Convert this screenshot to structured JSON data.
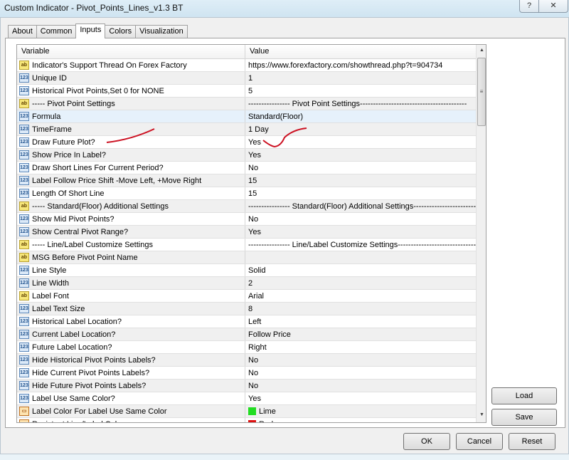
{
  "window": {
    "title": "Custom Indicator - Pivot_Points_Lines_v1.3 BT",
    "help": "?",
    "close": "✕"
  },
  "tabs": [
    {
      "label": "About"
    },
    {
      "label": "Common"
    },
    {
      "label": "Inputs",
      "active": true
    },
    {
      "label": "Colors"
    },
    {
      "label": "Visualization"
    }
  ],
  "grid": {
    "headers": {
      "variable": "Variable",
      "value": "Value"
    },
    "rows": [
      {
        "icon": "ab",
        "variable": "Indicator's Support Thread On Forex Factory",
        "value": "https://www.forexfactory.com/showthread.php?t=904734"
      },
      {
        "icon": "123",
        "variable": "Unique ID",
        "value": "1"
      },
      {
        "icon": "123",
        "variable": "Historical Pivot Points,Set 0 for NONE",
        "value": "5"
      },
      {
        "icon": "ab",
        "variable": "----- Pivot Point Settings",
        "value": "---------------- Pivot Point Settings-----------------------------------------"
      },
      {
        "icon": "123",
        "variable": "Formula",
        "value": "Standard(Floor)",
        "selected": true
      },
      {
        "icon": "123",
        "variable": "TimeFrame",
        "value": "1 Day"
      },
      {
        "icon": "123",
        "variable": "Draw Future Plot?",
        "value": "Yes"
      },
      {
        "icon": "123",
        "variable": "Show Price In Label?",
        "value": "Yes"
      },
      {
        "icon": "123",
        "variable": "Draw Short Lines For Current Period?",
        "value": "No"
      },
      {
        "icon": "123",
        "variable": "Label Follow Price Shift -Move Left, +Move Right",
        "value": "15"
      },
      {
        "icon": "123",
        "variable": "Length Of Short Line",
        "value": "15"
      },
      {
        "icon": "ab",
        "variable": "----- Standard(Floor) Additional Settings",
        "value": "---------------- Standard(Floor) Additional Settings-------------------------------"
      },
      {
        "icon": "123",
        "variable": "Show Mid Pivot Points?",
        "value": "No"
      },
      {
        "icon": "123",
        "variable": "Show Central Pivot Range?",
        "value": "Yes"
      },
      {
        "icon": "ab",
        "variable": "----- Line/Label Customize Settings",
        "value": "---------------- Line/Label Customize Settings---------------------------------"
      },
      {
        "icon": "ab",
        "variable": "MSG Before Pivot Point Name",
        "value": ""
      },
      {
        "icon": "123",
        "variable": "Line Style",
        "value": "Solid"
      },
      {
        "icon": "123",
        "variable": "Line Width",
        "value": "2"
      },
      {
        "icon": "ab",
        "variable": "Label Font",
        "value": "Arial"
      },
      {
        "icon": "123",
        "variable": "Label Text Size",
        "value": "8"
      },
      {
        "icon": "123",
        "variable": "Historical Label Location?",
        "value": "Left"
      },
      {
        "icon": "123",
        "variable": "Current Label Location?",
        "value": "Follow Price"
      },
      {
        "icon": "123",
        "variable": "Future Label Location?",
        "value": "Right"
      },
      {
        "icon": "123",
        "variable": "Hide Historical Pivot Points Labels?",
        "value": "No"
      },
      {
        "icon": "123",
        "variable": "Hide Current Pivot Points Labels?",
        "value": "No"
      },
      {
        "icon": "123",
        "variable": "Hide Future Pivot Points Labels?",
        "value": "No"
      },
      {
        "icon": "123",
        "variable": "Label Use Same Color?",
        "value": "Yes"
      },
      {
        "icon": "color",
        "variable": "Label Color For Label Use Same Color",
        "value": "Lime",
        "swatch": "#22dd22"
      },
      {
        "icon": "color",
        "variable": "Resistant Line/Label Color",
        "value": "Red",
        "swatch": "#dd1111"
      }
    ]
  },
  "buttons": {
    "load": "Load",
    "save": "Save",
    "ok": "OK",
    "cancel": "Cancel",
    "reset": "Reset"
  },
  "annotation_color": "#cc1122"
}
